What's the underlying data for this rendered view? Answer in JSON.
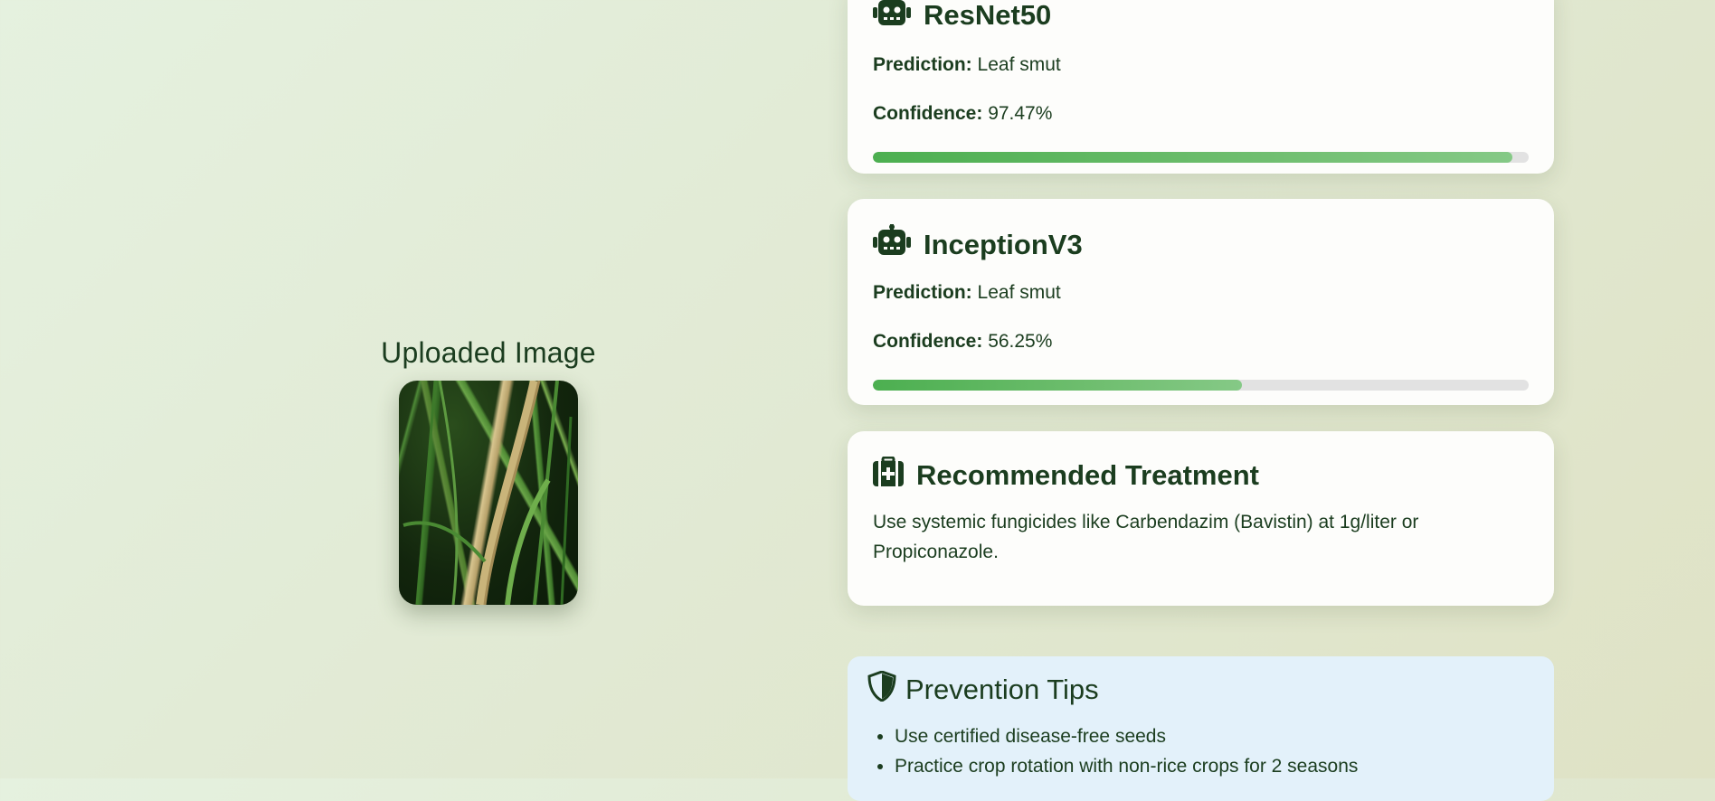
{
  "uploaded": {
    "heading": "Uploaded Image"
  },
  "models": [
    {
      "name": "ResNet50",
      "icon": "robot-icon",
      "prediction_label": "Prediction:",
      "prediction": "Leaf smut",
      "confidence_label": "Confidence:",
      "confidence": "97.47%",
      "confidence_fraction": 0.9747
    },
    {
      "name": "InceptionV3",
      "icon": "robot-icon",
      "prediction_label": "Prediction:",
      "prediction": "Leaf smut",
      "confidence_label": "Confidence:",
      "confidence": "56.25%",
      "confidence_fraction": 0.5625
    }
  ],
  "treatment": {
    "icon": "medkit-icon",
    "title": "Recommended Treatment",
    "text": "Use systemic fungicides like Carbendazim (Bavistin) at 1g/liter or Propiconazole."
  },
  "prevention": {
    "icon": "shield-icon",
    "title": "Prevention Tips",
    "tips": [
      "Use certified disease-free seeds",
      "Practice crop rotation with non-rice crops for 2 seasons"
    ]
  },
  "colors": {
    "text": "#1b3d1f",
    "bar_fill": "#4caf50",
    "bar_track": "#e2e2e2",
    "prevention_bg": "#e3f1fa"
  }
}
